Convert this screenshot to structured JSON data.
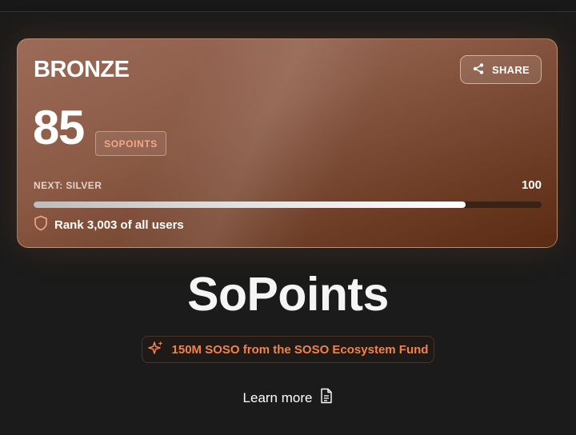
{
  "card": {
    "tier": "BRONZE",
    "share_label": "SHARE",
    "points": "85",
    "unit": "SOPOINTS",
    "next_label": "NEXT: SILVER",
    "next_value": "100",
    "progress_fraction": 0.85,
    "rank_text": "Rank 3,003 of all users"
  },
  "hero": {
    "title": "SoPoints",
    "fund_text": "150M SOSO from the SOSO Ecosystem Fund",
    "learn_more": "Learn more"
  },
  "colors": {
    "accent": "#f0834e",
    "bronze_dark": "#5a2a12",
    "bronze_light": "#9c6b58"
  },
  "icons": [
    "share-icon",
    "shield-icon",
    "sparkle-icon",
    "document-icon"
  ]
}
